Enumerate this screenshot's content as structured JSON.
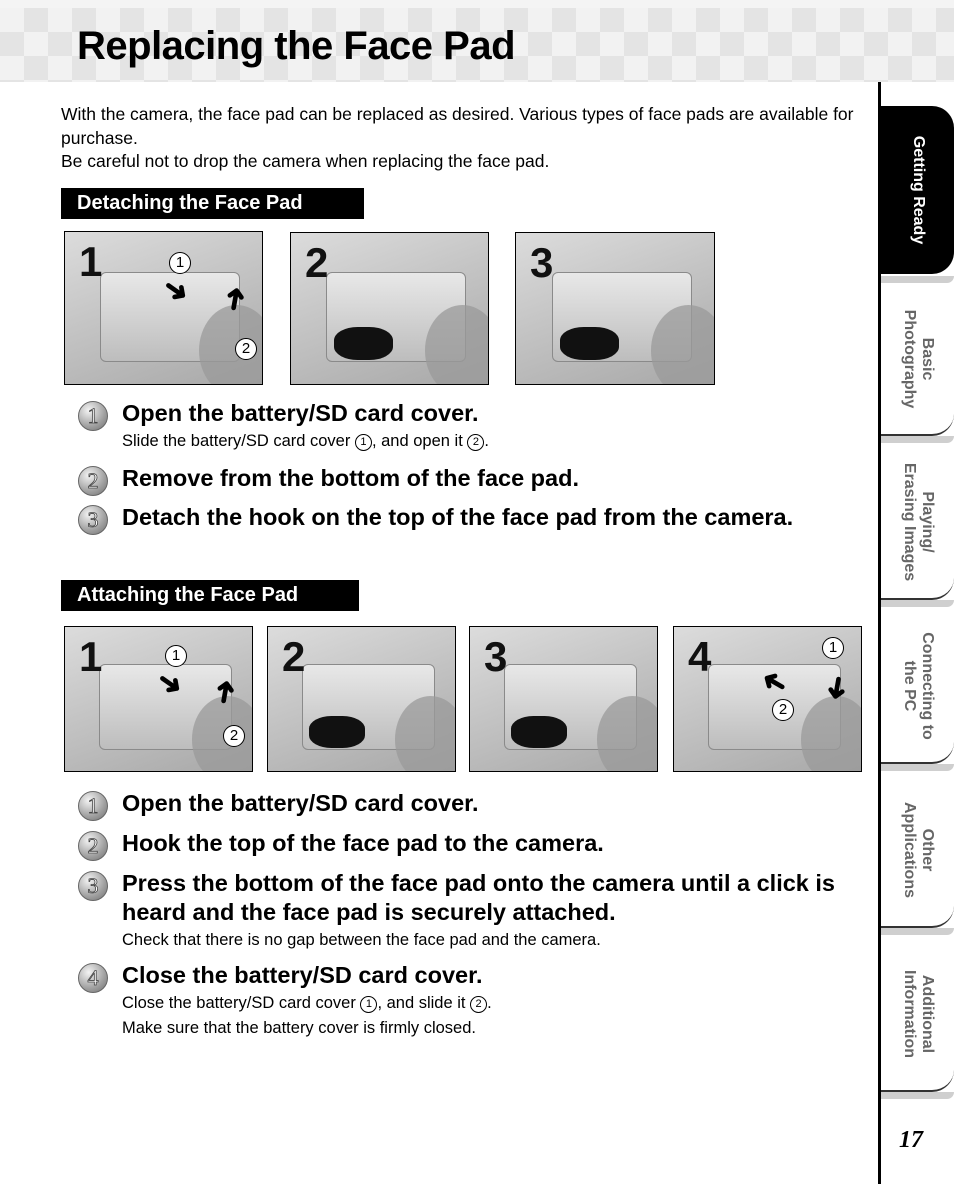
{
  "page": {
    "title": "Replacing the Face Pad",
    "intro": [
      "With the camera, the face pad can be replaced as desired. Various types of face pads are available for purchase.",
      "Be careful not to drop the camera when replacing the face pad."
    ],
    "page_number": "17"
  },
  "detaching": {
    "heading": "Detaching the Face Pad",
    "photos": [
      {
        "number": "1",
        "callouts": [
          "1",
          "2"
        ]
      },
      {
        "number": "2"
      },
      {
        "number": "3"
      }
    ],
    "steps": [
      {
        "icon": "1",
        "title": "Open the battery/SD card cover.",
        "note_parts": [
          "Slide the battery/SD card cover ",
          "1",
          ", and open it ",
          "2",
          "."
        ]
      },
      {
        "icon": "2",
        "title": "Remove from the bottom of the face pad."
      },
      {
        "icon": "3",
        "title": "Detach the hook on the top of the face pad from the camera."
      }
    ]
  },
  "attaching": {
    "heading": "Attaching the Face Pad",
    "photos": [
      {
        "number": "1",
        "callouts": [
          "1",
          "2"
        ]
      },
      {
        "number": "2"
      },
      {
        "number": "3"
      },
      {
        "number": "4",
        "callouts": [
          "1",
          "2"
        ]
      }
    ],
    "steps": [
      {
        "icon": "1",
        "title": "Open the battery/SD card cover."
      },
      {
        "icon": "2",
        "title": "Hook the top of the face pad to the camera."
      },
      {
        "icon": "3",
        "title": "Press the bottom of the face pad onto the camera until a click is heard and the face pad is securely attached.",
        "note": "Check that there is no gap between the face pad and the camera."
      },
      {
        "icon": "4",
        "title": "Close the battery/SD card cover.",
        "note_parts": [
          "Close the battery/SD card cover ",
          "1",
          ", and slide it ",
          "2",
          "."
        ],
        "note2": "Make sure that the battery cover is firmly closed."
      }
    ]
  },
  "sidebar": {
    "tabs": [
      {
        "label_lines": [
          "Getting Ready"
        ],
        "active": true
      },
      {
        "label_lines": [
          "Basic",
          "Photography"
        ]
      },
      {
        "label_lines": [
          "Playing/",
          "Erasing Images"
        ]
      },
      {
        "label_lines": [
          "Connecting to",
          "the PC"
        ]
      },
      {
        "label_lines": [
          "Other",
          "Applications"
        ]
      },
      {
        "label_lines": [
          "Additional",
          "Information"
        ]
      }
    ]
  },
  "colors": {
    "section_bar": "#000000",
    "active_tab": "#000000",
    "inactive_tab_text": "#666666"
  }
}
